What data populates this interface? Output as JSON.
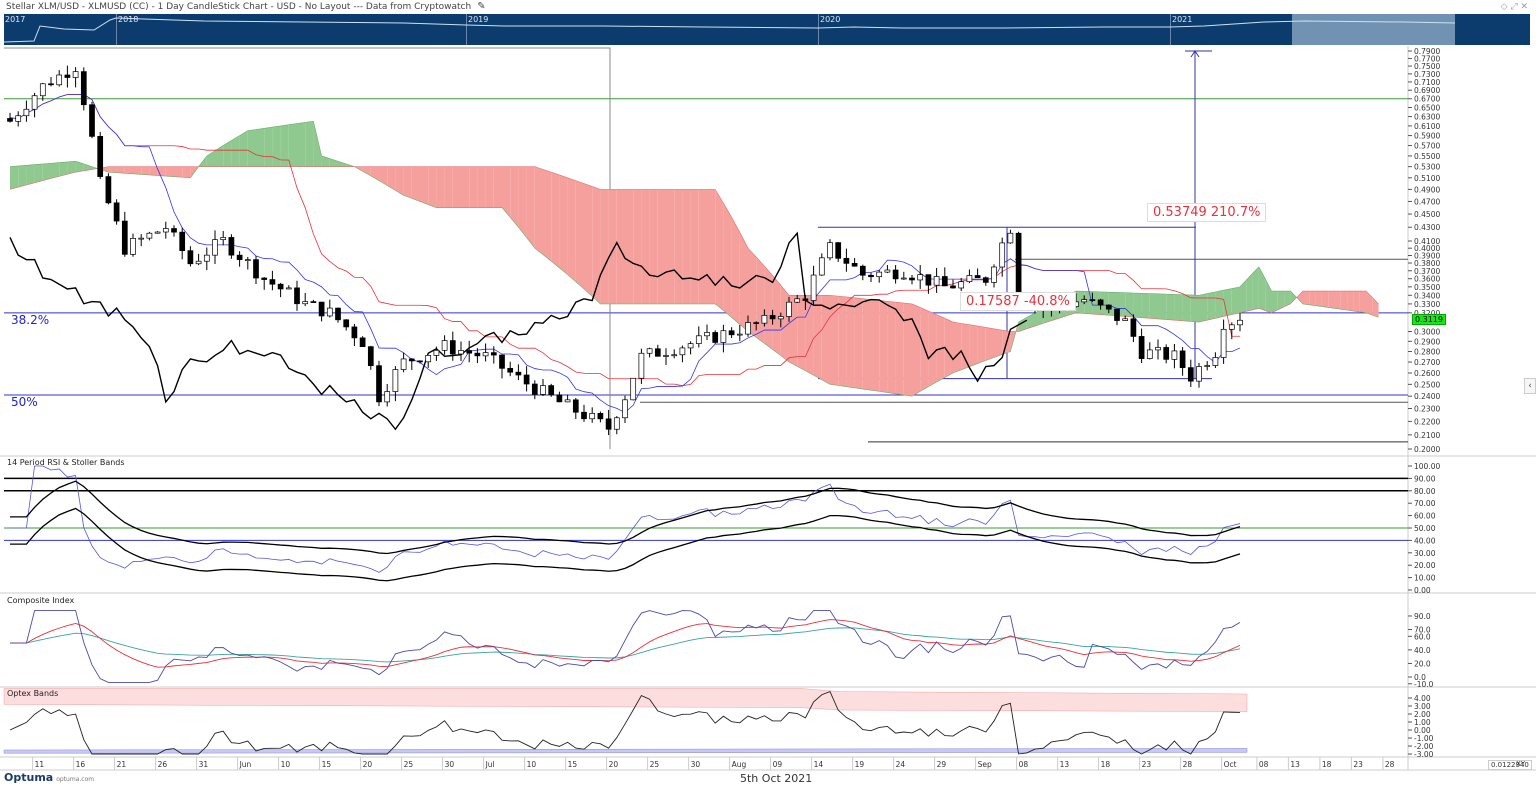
{
  "header": {
    "title": "Stellar XLM/USD - XLMUSD (CC) - 1 Day CandleStick Chart - USD - No Layout --- Data from Cryptowatch",
    "edit_icon": "pencil-icon"
  },
  "overview": {
    "years": [
      "2017",
      "2018",
      "2019",
      "2020",
      "2021"
    ]
  },
  "price_axis": {
    "ticks": [
      "0.7900",
      "0.7700",
      "0.7500",
      "0.7300",
      "0.7100",
      "0.6900",
      "0.6700",
      "0.6500",
      "0.6300",
      "0.6100",
      "0.5900",
      "0.5700",
      "0.5500",
      "0.5300",
      "0.5100",
      "0.4900",
      "0.4700",
      "0.4500",
      "0.4300",
      "0.4100",
      "0.4000",
      "0.3900",
      "0.3800",
      "0.3700",
      "0.3600",
      "0.3500",
      "0.3400",
      "0.3300",
      "0.3200",
      "0.3000",
      "0.2900",
      "0.2800",
      "0.2700",
      "0.2600",
      "0.2500",
      "0.2400",
      "0.2300",
      "0.2200",
      "0.2100",
      "0.2000"
    ],
    "last_price": "0.3119"
  },
  "annotations": {
    "fib_382": "38.2%",
    "fib_50": "50%",
    "measure_up": "0.53749  210.7%",
    "measure_down": "0.17587  -40.8%"
  },
  "rsi_panel": {
    "label": "14 Period RSI & Stoller Bands",
    "ticks": [
      "100.00",
      "90.00",
      "80.00",
      "70.00",
      "60.00",
      "50.00",
      "40.00",
      "30.00",
      "20.00",
      "10.00",
      "0.00"
    ]
  },
  "composite_panel": {
    "label": "Composite Index",
    "ticks": [
      "90.0",
      "70.0",
      "60.0",
      "40.0",
      "20.0",
      "0.0",
      "-10.0"
    ]
  },
  "optex_panel": {
    "label": "Optex Bands",
    "ticks": [
      "4.00",
      "3.00",
      "2.00",
      "1.00",
      "0.00",
      "-1.00",
      "-2.00",
      "-3.00"
    ]
  },
  "date_axis": {
    "ticks": [
      "11",
      "16",
      "21",
      "26",
      "31",
      "Jun",
      "10",
      "15",
      "20",
      "25",
      "30",
      "Jul",
      "10",
      "15",
      "20",
      "25",
      "30",
      "Aug",
      "09",
      "14",
      "19",
      "24",
      "29",
      "Sep",
      "08",
      "13",
      "18",
      "23",
      "28",
      "Oct",
      "08",
      "13",
      "18",
      "23",
      "28"
    ]
  },
  "footer": {
    "logo": "Optuma",
    "logo_sub": "optuma.com",
    "date": "5th Oct 2021",
    "scale": "0.0122940",
    "xy": "XY"
  },
  "colors": {
    "up_cloud": "#8fc98f",
    "down_cloud": "#f6a09e",
    "tenkan": "#3333ee",
    "kijun": "#e8323c",
    "chikou": "#000000",
    "overview": "#0b3c6d"
  },
  "chart_data": {
    "type": "candlestick",
    "title": "Stellar XLM/USD 1 Day",
    "ylim": [
      0.2,
      0.79
    ],
    "yscale": "log",
    "close_keypoints": [
      [
        0,
        0.62
      ],
      [
        4,
        0.7
      ],
      [
        8,
        0.75
      ],
      [
        11,
        0.5
      ],
      [
        14,
        0.4
      ],
      [
        19,
        0.43
      ],
      [
        22,
        0.38
      ],
      [
        26,
        0.41
      ],
      [
        31,
        0.36
      ],
      [
        36,
        0.33
      ],
      [
        39,
        0.32
      ],
      [
        43,
        0.29
      ],
      [
        45,
        0.24
      ],
      [
        48,
        0.27
      ],
      [
        53,
        0.285
      ],
      [
        58,
        0.275
      ],
      [
        62,
        0.255
      ],
      [
        67,
        0.235
      ],
      [
        73,
        0.215
      ],
      [
        75,
        0.24
      ],
      [
        77,
        0.275
      ],
      [
        84,
        0.29
      ],
      [
        92,
        0.31
      ],
      [
        97,
        0.34
      ],
      [
        100,
        0.4
      ],
      [
        104,
        0.365
      ],
      [
        109,
        0.37
      ],
      [
        114,
        0.35
      ],
      [
        119,
        0.36
      ],
      [
        122,
        0.43
      ],
      [
        123,
        0.34
      ],
      [
        126,
        0.325
      ],
      [
        131,
        0.335
      ],
      [
        136,
        0.31
      ],
      [
        138,
        0.28
      ],
      [
        142,
        0.275
      ],
      [
        144,
        0.257
      ],
      [
        147,
        0.28
      ],
      [
        148,
        0.31
      ],
      [
        150,
        0.3119
      ]
    ],
    "cloud_keypoints": [
      [
        0,
        0.53,
        0.49
      ],
      [
        8,
        0.54,
        0.52
      ],
      [
        12,
        0.52,
        0.53
      ],
      [
        22,
        0.51,
        0.53
      ],
      [
        24,
        0.55,
        0.53
      ],
      [
        29,
        0.6,
        0.53
      ],
      [
        37,
        0.62,
        0.53
      ],
      [
        38,
        0.55,
        0.53
      ],
      [
        42,
        0.53,
        0.53
      ],
      [
        48,
        0.48,
        0.53
      ],
      [
        52,
        0.46,
        0.53
      ],
      [
        60,
        0.46,
        0.53
      ],
      [
        64,
        0.4,
        0.53
      ],
      [
        72,
        0.33,
        0.49
      ],
      [
        86,
        0.33,
        0.49
      ],
      [
        90,
        0.3,
        0.4
      ],
      [
        95,
        0.27,
        0.34
      ],
      [
        100,
        0.25,
        0.34
      ],
      [
        110,
        0.24,
        0.33
      ],
      [
        115,
        0.26,
        0.31
      ],
      [
        122,
        0.28,
        0.3
      ],
      [
        123,
        0.31,
        0.3
      ],
      [
        130,
        0.345,
        0.32
      ],
      [
        145,
        0.34,
        0.31
      ],
      [
        150,
        0.35,
        0.32
      ],
      [
        153,
        0.375,
        0.325
      ],
      [
        155,
        0.345,
        0.32
      ],
      [
        158,
        0.345,
        0.33
      ],
      [
        160,
        0.33,
        0.345
      ],
      [
        170,
        0.32,
        0.345
      ],
      [
        172,
        0.315,
        0.33
      ]
    ],
    "levels": {
      "fib_382": 0.32,
      "fib_50": 0.241,
      "green_high": 0.67,
      "resistance": 0.385,
      "support": 0.235,
      "low": 0.205,
      "measure_top": 0.43,
      "measure_bottom": 0.255,
      "target": 0.79
    }
  }
}
